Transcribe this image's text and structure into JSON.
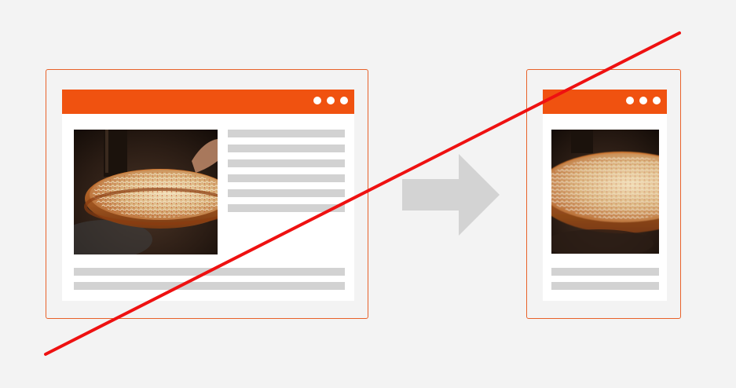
{
  "colors": {
    "accent": "#f05210",
    "frame_border": "#e8622a",
    "placeholder": "#d2d2d2",
    "arrow": "#d3d3d3",
    "strike": "#ee1111",
    "background": "#f3f3f3"
  },
  "icons": {
    "window_menu": "three-dots-icon",
    "transition": "right-arrow-icon",
    "strike": "diagonal-strike-line"
  },
  "desktop_layout": {
    "titlebar_dots": 3,
    "text_lines_beside_image": 6,
    "text_lines_below_image": 2,
    "image": "pizza-photo"
  },
  "mobile_layout": {
    "titlebar_dots": 3,
    "text_lines_below_image": 2,
    "image": "pizza-photo"
  }
}
